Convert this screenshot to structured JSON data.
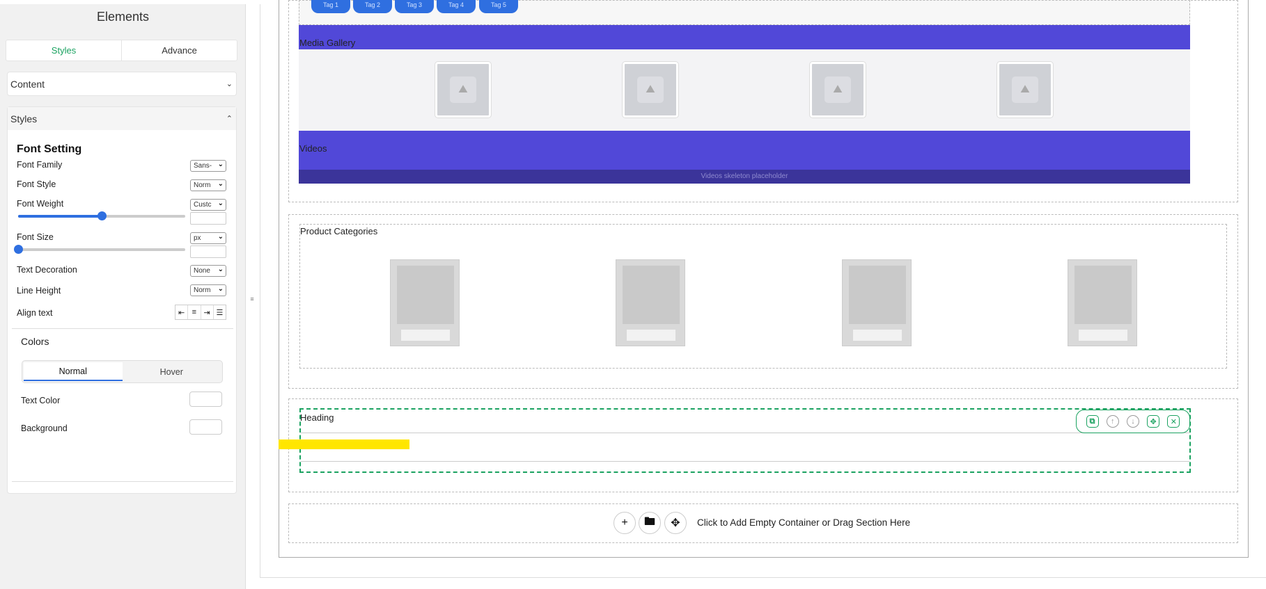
{
  "sidebar": {
    "title": "Elements",
    "tabs": [
      {
        "label": "Styles",
        "active": true
      },
      {
        "label": "Advance",
        "active": false
      }
    ],
    "content_section": {
      "label": "Content"
    },
    "styles_section": {
      "label": "Styles",
      "font_setting_title": "Font Setting",
      "font_family": {
        "label": "Font Family",
        "value": "Sans-"
      },
      "font_style": {
        "label": "Font Style",
        "value": "Norm"
      },
      "font_weight": {
        "label": "Font Weight",
        "value": "Custc",
        "slider_fraction": 0.5
      },
      "font_size": {
        "label": "Font Size",
        "value": "px",
        "slider_fraction": 0.0
      },
      "text_decoration": {
        "label": "Text Decoration",
        "value": "None"
      },
      "line_height": {
        "label": "Line Height",
        "value": "Norm"
      },
      "align_text": {
        "label": "Align text",
        "icons": [
          "align-left-icon",
          "align-center-icon",
          "align-right-icon",
          "align-justify-icon"
        ]
      },
      "colors": {
        "title": "Colors",
        "modes": [
          {
            "label": "Normal",
            "active": true
          },
          {
            "label": "Hover",
            "active": false
          }
        ],
        "text_color_label": "Text Color",
        "background_label": "Background"
      }
    }
  },
  "canvas": {
    "tags": [
      "Tag 1",
      "Tag 2",
      "Tag 3",
      "Tag 4",
      "Tag 5"
    ],
    "media_gallery_label": "Media Gallery",
    "videos_label": "Videos",
    "videos_placeholder": "Videos skeleton placeholder",
    "product_categories_label": "Product Categories",
    "heading_label": "Heading",
    "add_section_text": "Click to Add Empty Container or Drag Section Here"
  },
  "colors": {
    "accent_green": "#1aa260",
    "accent_blue": "#2f6fe0",
    "band_purple": "#5148d8",
    "highlight_yellow": "#ffe600"
  }
}
